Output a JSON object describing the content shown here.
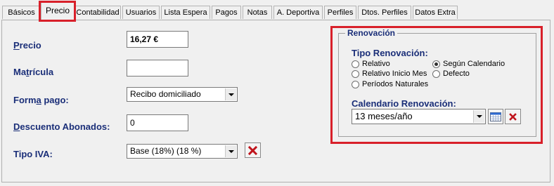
{
  "tabs": [
    {
      "label": "Básicos"
    },
    {
      "label": "Precio"
    },
    {
      "label": "Contabilidad"
    },
    {
      "label": "Usuarios"
    },
    {
      "label": "Lista Espera"
    },
    {
      "label": "Pagos"
    },
    {
      "label": "Notas"
    },
    {
      "label": "A. Deportiva"
    },
    {
      "label": "Perfiles"
    },
    {
      "label": "Dtos. Perfiles"
    },
    {
      "label": "Datos Extra"
    }
  ],
  "active_tab": "Precio",
  "form": {
    "precio": {
      "label_pre": "",
      "label_u": "P",
      "label_post": "recio",
      "value": "16,27 €"
    },
    "matricula": {
      "label_pre": "Ma",
      "label_u": "t",
      "label_post": "rícula",
      "value": ""
    },
    "forma_pago": {
      "label_pre": "Form",
      "label_u": "a",
      "label_post": " pago:",
      "value": "Recibo domiciliado"
    },
    "descuento": {
      "label_pre": "",
      "label_u": "D",
      "label_post": "escuento Abonados:",
      "value": "0"
    },
    "tipo_iva": {
      "label": "Tipo IVA:",
      "value": "Base (18%)  (18 %)"
    }
  },
  "renovacion": {
    "group_title": "Renovación",
    "tipo_label": "Tipo Renovación:",
    "options": [
      {
        "label": "Relativo",
        "checked": false
      },
      {
        "label": "Según Calendario",
        "checked": true
      },
      {
        "label": "Relativo Inicio Mes",
        "checked": false
      },
      {
        "label": "Defecto",
        "checked": false
      },
      {
        "label": "Períodos Naturales",
        "checked": false
      }
    ],
    "calendario_label": "Calendario Renovación:",
    "calendario_value": "13 meses/año"
  },
  "colors": {
    "highlight": "#d8202a",
    "label": "#1a2e78",
    "x_icon": "#c0141c"
  },
  "icons": {
    "delete": "x-icon",
    "calendar": "calendar-grid-icon",
    "dropdown": "chevron-down-icon"
  }
}
